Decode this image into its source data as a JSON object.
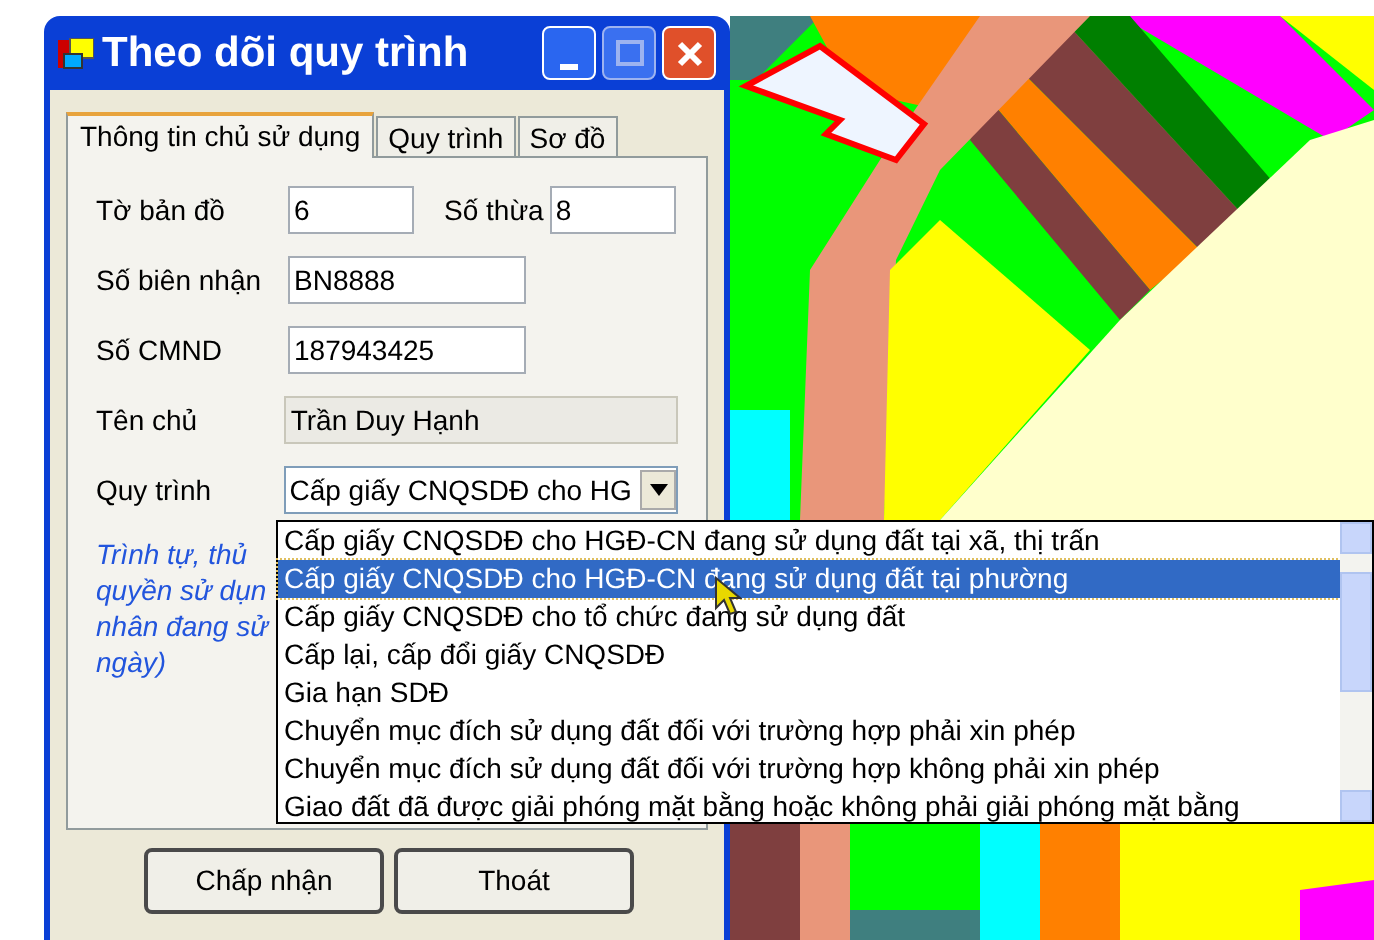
{
  "window": {
    "title": "Theo dõi quy trình"
  },
  "tabs": [
    {
      "label": "Thông tin chủ sử dụng",
      "selected": true
    },
    {
      "label": "Quy trình",
      "selected": false
    },
    {
      "label": "Sơ đồ",
      "selected": false
    }
  ],
  "form_rows": [
    [
      {
        "label": "Tờ bản đồ",
        "value": "6",
        "disabled": false
      },
      {
        "label": "Số thừa",
        "value": "8",
        "disabled": false
      }
    ],
    [
      {
        "label": "Số biên nhận",
        "value": "BN8888",
        "disabled": false
      }
    ],
    [
      {
        "label": "Số CMND",
        "value": "187943425",
        "disabled": false
      }
    ],
    [
      {
        "label": "Tên chủ",
        "value": "Trần Duy Hạnh",
        "disabled": true
      }
    ]
  ],
  "process": {
    "label": "Quy trình",
    "value": "Cấp giấy CNQSDĐ cho HG"
  },
  "note_lines": [
    "Trình tự, thủ",
    "quyền sử dụn",
    "nhân đang sử",
    "ngày)"
  ],
  "dropdown_items": [
    {
      "label": "Cấp giấy CNQSDĐ cho HGĐ-CN đang sử dụng đất tại xã, thị trấn",
      "selected": false
    },
    {
      "label": "Cấp giấy CNQSDĐ cho HGĐ-CN đang sử dụng đất tại phường",
      "selected": true
    },
    {
      "label": "Cấp giấy CNQSDĐ cho tổ chức đang sử dụng đất",
      "selected": false
    },
    {
      "label": "Cấp lại, cấp đổi giấy CNQSDĐ",
      "selected": false
    },
    {
      "label": "Gia hạn SDĐ",
      "selected": false
    },
    {
      "label": "Chuyển mục đích sử dụng đất đối với trường hợp phải xin phép",
      "selected": false
    },
    {
      "label": "Chuyển mục đích sử dụng đất đối với trường hợp không phải xin phép",
      "selected": false
    },
    {
      "label": "Giao đất đã được giải phóng mặt bằng hoặc không phải giải phóng mặt bằng",
      "selected": false
    }
  ],
  "buttons": [
    "Chấp nhận",
    "Thoát"
  ]
}
